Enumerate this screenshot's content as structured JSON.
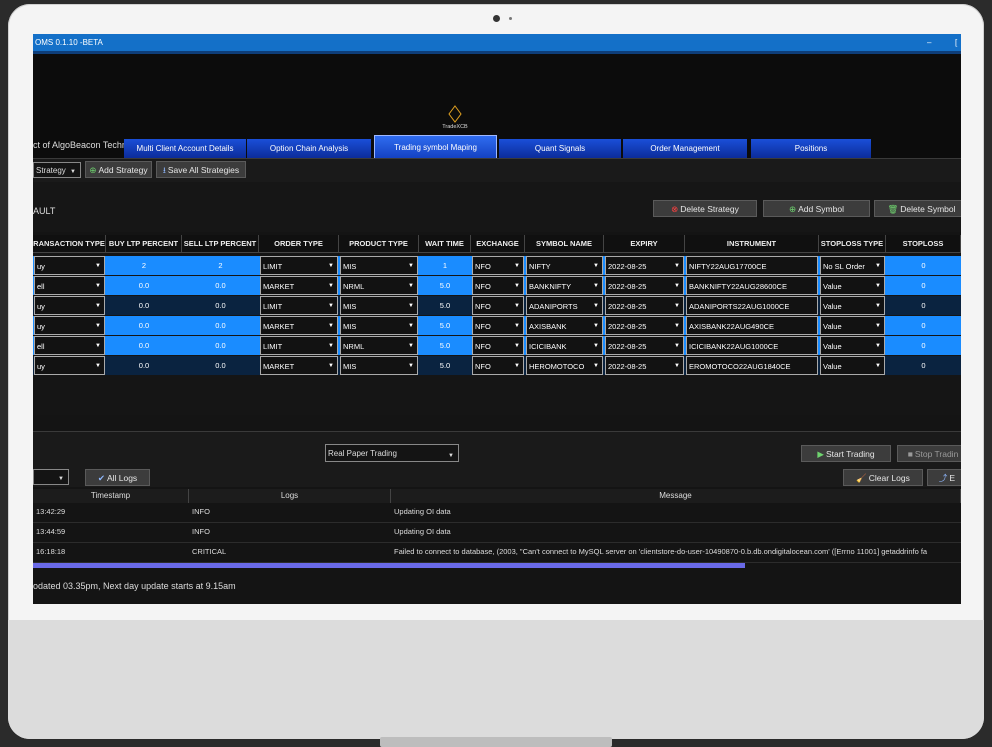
{
  "window": {
    "title": "OMS 0.1.10 -BETA",
    "minimize": "–",
    "extra": "["
  },
  "logo_text": "TradeXCB",
  "product_line": "ct of AlgoBeacon Technologies",
  "tabs": [
    {
      "label": "Multi Client Account Details"
    },
    {
      "label": "Option Chain Analysis"
    },
    {
      "label": "Trading symbol Maping"
    },
    {
      "label": "Quant Signals"
    },
    {
      "label": "Order Management"
    },
    {
      "label": "Positions"
    }
  ],
  "toolbar": {
    "strategy_select": "Strategy",
    "add_strategy": "Add Strategy",
    "save_all": "Save All Strategies"
  },
  "strategy_name": "AULT",
  "strategy_actions": {
    "delete_strategy": "Delete Strategy",
    "add_symbol": "Add Symbol",
    "delete_symbol": "Delete Symbol"
  },
  "columns": [
    "RANSACTION TYPE",
    "BUY LTP PERCENT",
    "SELL LTP PERCENT",
    "ORDER TYPE",
    "PRODUCT TYPE",
    "WAIT TIME",
    "EXCHANGE",
    "SYMBOL NAME",
    "EXPIRY",
    "INSTRUMENT",
    "STOPLOSS TYPE",
    "STOPLOSS"
  ],
  "rows": [
    {
      "txn": "uy",
      "buy": "2",
      "sell": "2",
      "order": "LIMIT",
      "product": "MIS",
      "wait": "1",
      "exch": "NFO",
      "symbol": "NIFTY",
      "expiry": "2022-08-25",
      "instrument": "NIFTY22AUG17700CE",
      "sltype": "No SL Order",
      "sl": "0"
    },
    {
      "txn": "ell",
      "buy": "0.0",
      "sell": "0.0",
      "order": "MARKET",
      "product": "NRML",
      "wait": "5.0",
      "exch": "NFO",
      "symbol": "BANKNIFTY",
      "expiry": "2022-08-25",
      "instrument": "BANKNIFTY22AUG28600CE",
      "sltype": "Value",
      "sl": "0"
    },
    {
      "txn": "uy",
      "buy": "0.0",
      "sell": "0.0",
      "order": "LIMIT",
      "product": "MIS",
      "wait": "5.0",
      "exch": "NFO",
      "symbol": "ADANIPORTS",
      "expiry": "2022-08-25",
      "instrument": "ADANIPORTS22AUG1000CE",
      "sltype": "Value",
      "sl": "0"
    },
    {
      "txn": "uy",
      "buy": "0.0",
      "sell": "0.0",
      "order": "MARKET",
      "product": "MIS",
      "wait": "5.0",
      "exch": "NFO",
      "symbol": "AXISBANK",
      "expiry": "2022-08-25",
      "instrument": "AXISBANK22AUG490CE",
      "sltype": "Value",
      "sl": "0"
    },
    {
      "txn": "ell",
      "buy": "0.0",
      "sell": "0.0",
      "order": "LIMIT",
      "product": "NRML",
      "wait": "5.0",
      "exch": "NFO",
      "symbol": "ICICIBANK",
      "expiry": "2022-08-25",
      "instrument": "ICICIBANK22AUG1000CE",
      "sltype": "Value",
      "sl": "0"
    },
    {
      "txn": "uy",
      "buy": "0.0",
      "sell": "0.0",
      "order": "MARKET",
      "product": "MIS",
      "wait": "5.0",
      "exch": "NFO",
      "symbol": "HEROMOTOCO",
      "expiry": "2022-08-25",
      "instrument": "EROMOTOCO22AUG1840CE",
      "sltype": "Value",
      "sl": "0"
    }
  ],
  "trading": {
    "mode_select": "Real Paper Trading",
    "start": "Start Trading",
    "stop": "Stop Tradin"
  },
  "logs_toolbar": {
    "all_logs": "All Logs",
    "clear_logs": "Clear Logs",
    "export": "E"
  },
  "log_columns": [
    "Timestamp",
    "Logs",
    "Message"
  ],
  "log_rows": [
    {
      "time": "13:42:29",
      "level": "INFO",
      "message": "Updating OI data"
    },
    {
      "time": "13:44:59",
      "level": "INFO",
      "message": "Updating OI data"
    },
    {
      "time": "16:18:18",
      "level": "CRITICAL",
      "message": "Failed to connect to database, (2003, \"Can't connect to MySQL server on 'clientstore-do-user-10490870-0.b.db.ondigitalocean.com' ([Errno 11001] getaddrinfo fa"
    }
  ],
  "status_text": "odated 03.35pm, Next day update starts at 9.15am",
  "colors": {
    "highlight": "#1a8cff",
    "tab": "#1a4fd8",
    "titlebar": "#1470c8",
    "scroll": "#6a6ae8"
  }
}
